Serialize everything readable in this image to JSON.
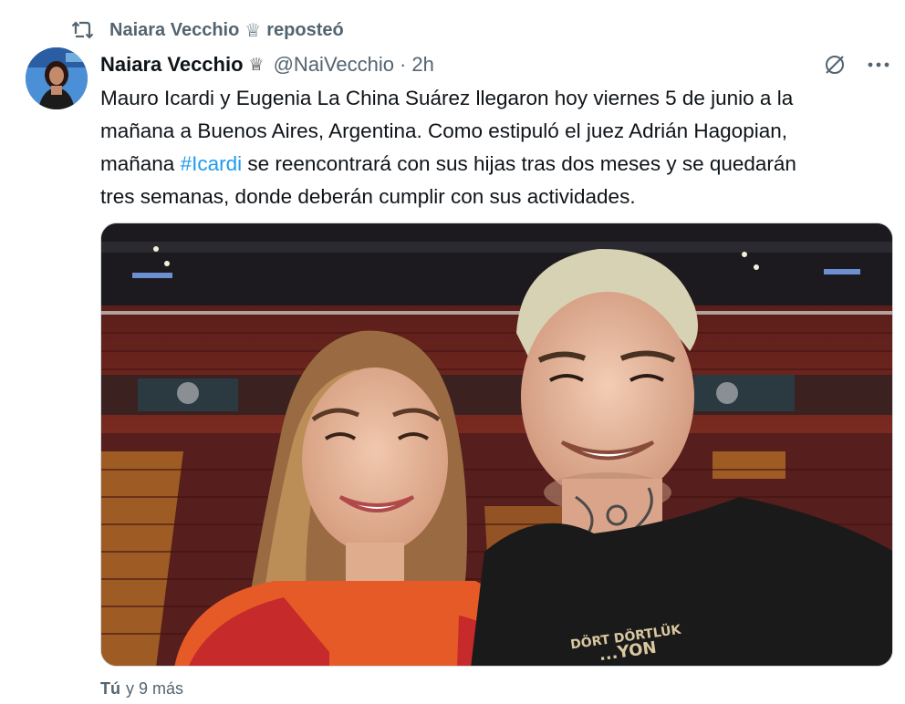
{
  "repost": {
    "user": "Naiara Vecchio",
    "crown": "♕",
    "action": "reposteó",
    "icon": "repost-icon"
  },
  "author": {
    "display_name": "Naiara Vecchio",
    "crown": "♕",
    "handle": "@NaiVecchio",
    "separator": "·",
    "time": "2h",
    "avatar": "avatar-photo"
  },
  "actions": {
    "grok_icon": "slash-circle-icon",
    "more_icon": "more-horizontal-icon"
  },
  "text": {
    "line1": "Mauro Icardi y Eugenia La China Suárez llegaron hoy viernes 5 de junio a la",
    "line2": "mañana a Buenos Aires, Argentina. Como estipuló el juez Adrián Hagopian,",
    "line3_before": "mañana ",
    "hashtag": "#Icardi",
    "line3_after": " se reencontrará con sus hijas tras dos meses y se quedarán",
    "line4": "tres semanas, donde deberán cumplir con sus actividades."
  },
  "media": {
    "shirt_text_1": "DÖRT DÖRTLÜK",
    "shirt_text_2": "...YON"
  },
  "footer": {
    "strong": "Tú",
    "rest": "y 9 más"
  },
  "colors": {
    "link": "#1d9bf0",
    "secondary": "#536471",
    "primary": "#0f1419"
  }
}
